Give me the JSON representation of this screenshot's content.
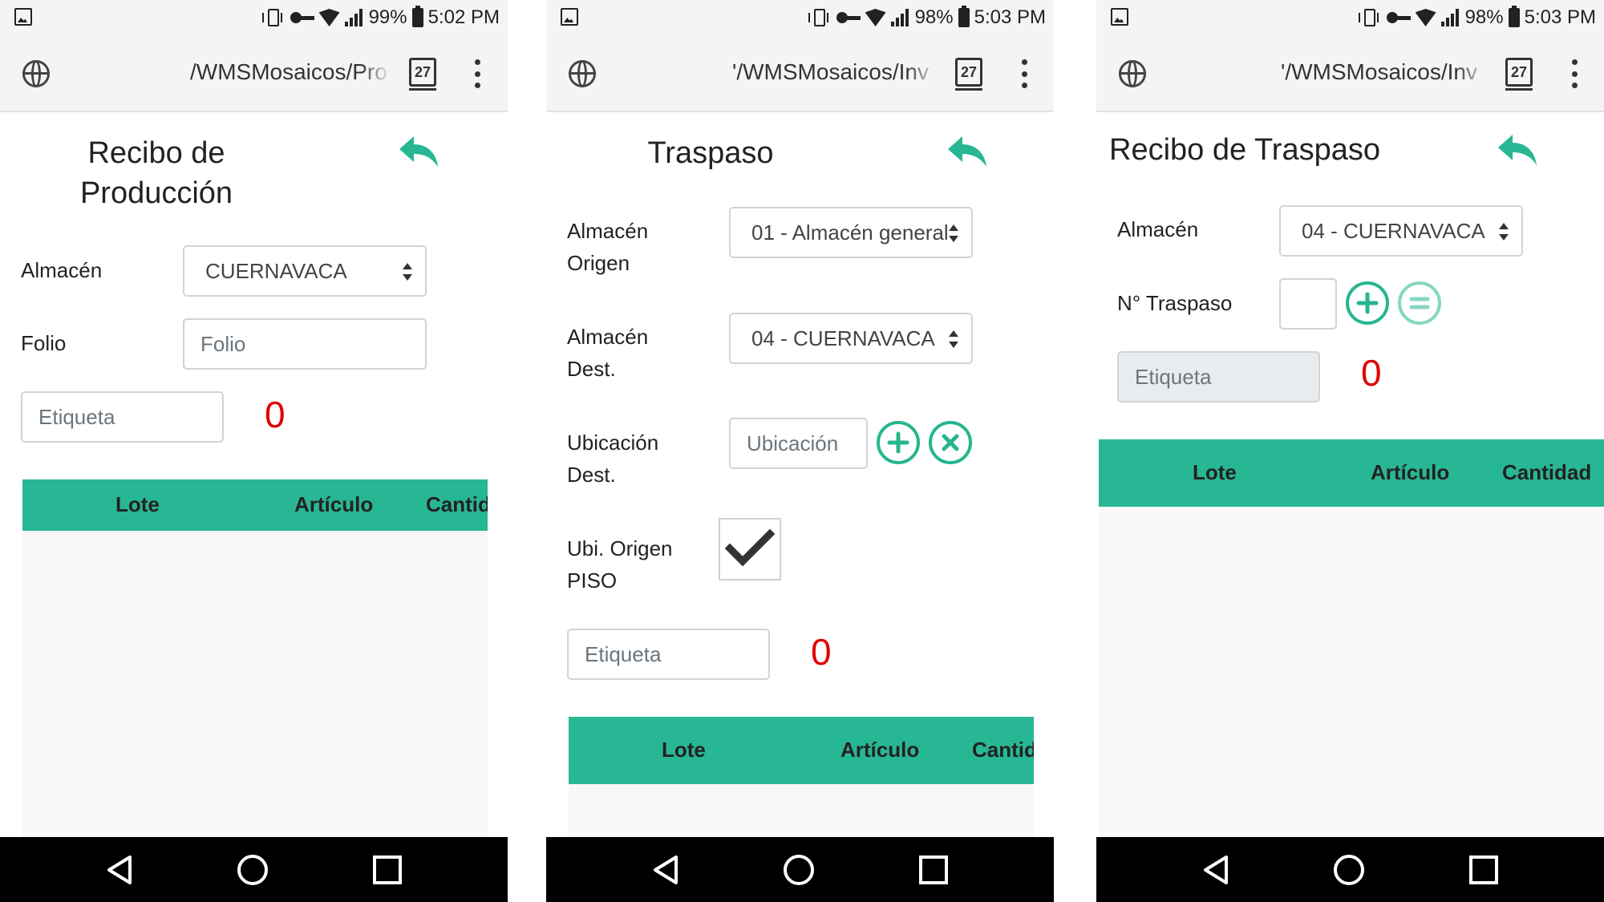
{
  "screens": [
    {
      "status": {
        "battery": "99%",
        "time": "5:02 PM"
      },
      "url": "/WMSMosaicos/Pro",
      "tab_count": "27",
      "title": "Recibo de Producción",
      "fields": {
        "almacen_label": "Almacén",
        "almacen_value": "CUERNAVACA",
        "folio_label": "Folio",
        "folio_placeholder": "Folio",
        "etiqueta_placeholder": "Etiqueta"
      },
      "counter": "0",
      "table_headers": [
        "Lote",
        "Artículo",
        "Cantid"
      ]
    },
    {
      "status": {
        "battery": "98%",
        "time": "5:03 PM"
      },
      "url": "'/WMSMosaicos/Inv",
      "tab_count": "27",
      "title": "Traspaso",
      "fields": {
        "origen_label_1": "Almacén",
        "origen_label_2": "Origen",
        "origen_value": "01 - Almacén general",
        "dest_label_1": "Almacén",
        "dest_label_2": "Dest.",
        "dest_value": "04 - CUERNAVACA",
        "ubicacion_label_1": "Ubicación",
        "ubicacion_label_2": "Dest.",
        "ubicacion_placeholder": "Ubicación",
        "ubi_origen_label_1": "Ubi. Origen",
        "ubi_origen_label_2": "PISO",
        "ubi_origen_checked": true,
        "etiqueta_placeholder": "Etiqueta"
      },
      "counter": "0",
      "table_headers": [
        "Lote",
        "Artículo",
        "Cantid"
      ]
    },
    {
      "status": {
        "battery": "98%",
        "time": "5:03 PM"
      },
      "url": "'/WMSMosaicos/Inv",
      "tab_count": "27",
      "title": "Recibo de Traspaso",
      "fields": {
        "almacen_label": "Almacén",
        "almacen_value": "04 - CUERNAVACA",
        "traspaso_label": "N° Traspaso",
        "etiqueta_placeholder": "Etiqueta"
      },
      "counter": "0",
      "table_headers": [
        "Lote",
        "Artículo",
        "Cantidad"
      ]
    }
  ],
  "colors": {
    "accent": "#28b794",
    "counter": "#e00000",
    "navbar": "#000000"
  },
  "icons": [
    "gallery-icon",
    "vibrate-icon",
    "vpn-key-icon",
    "wifi-icon",
    "signal-icon",
    "battery-icon",
    "globe-icon",
    "tabs-icon",
    "overflow-menu-icon",
    "reply-arrow-icon",
    "plus-circle-icon",
    "x-circle-icon",
    "equals-circle-icon",
    "checkmark-icon",
    "nav-back-icon",
    "nav-home-icon",
    "nav-recents-icon"
  ]
}
